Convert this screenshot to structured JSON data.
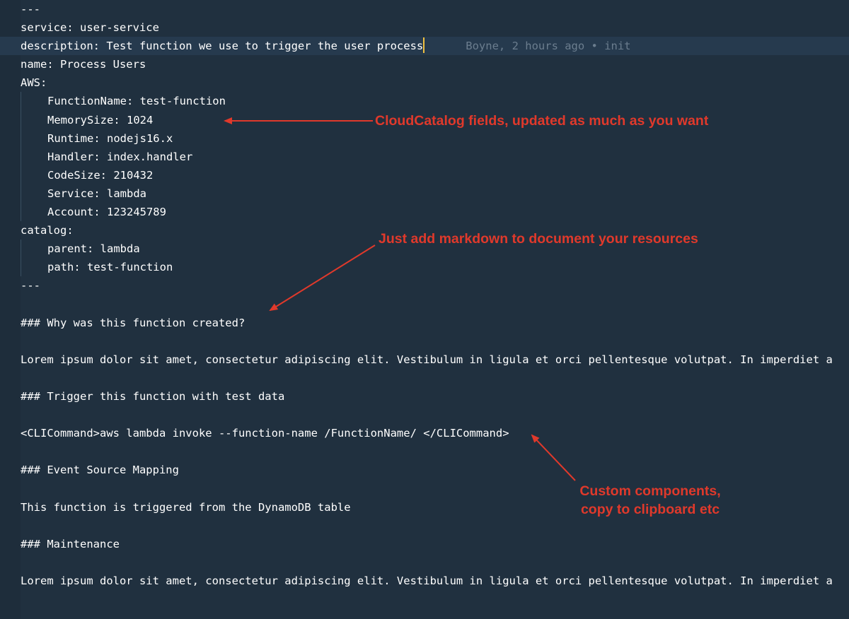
{
  "editor": {
    "lines": [
      {
        "indent": 0,
        "text": "---"
      },
      {
        "indent": 0,
        "text": "service: user-service"
      },
      {
        "indent": 0,
        "text": "description: Test function we use to trigger the user process",
        "active": true,
        "blame": "Boyne, 2 hours ago • init"
      },
      {
        "indent": 0,
        "text": "name: Process Users"
      },
      {
        "indent": 0,
        "text": "AWS:"
      },
      {
        "indent": 1,
        "text": "FunctionName: test-function"
      },
      {
        "indent": 1,
        "text": "MemorySize: 1024"
      },
      {
        "indent": 1,
        "text": "Runtime: nodejs16.x"
      },
      {
        "indent": 1,
        "text": "Handler: index.handler"
      },
      {
        "indent": 1,
        "text": "CodeSize: 210432"
      },
      {
        "indent": 1,
        "text": "Service: lambda"
      },
      {
        "indent": 1,
        "text": "Account: 123245789"
      },
      {
        "indent": 0,
        "text": "catalog:"
      },
      {
        "indent": 1,
        "text": "parent: lambda"
      },
      {
        "indent": 1,
        "text": "path: test-function"
      },
      {
        "indent": 0,
        "text": "---"
      },
      {
        "indent": 0,
        "text": ""
      },
      {
        "indent": 0,
        "text": "### Why was this function created?"
      },
      {
        "indent": 0,
        "text": ""
      },
      {
        "indent": 0,
        "text": "Lorem ipsum dolor sit amet, consectetur adipiscing elit. Vestibulum in ligula et orci pellentesque volutpat. In imperdiet a"
      },
      {
        "indent": 0,
        "text": ""
      },
      {
        "indent": 0,
        "text": "### Trigger this function with test data"
      },
      {
        "indent": 0,
        "text": ""
      },
      {
        "indent": 0,
        "text": "<CLICommand>aws lambda invoke --function-name /FunctionName/ </CLICommand>"
      },
      {
        "indent": 0,
        "text": ""
      },
      {
        "indent": 0,
        "text": "### Event Source Mapping"
      },
      {
        "indent": 0,
        "text": ""
      },
      {
        "indent": 0,
        "text": "This function is triggered from the DynamoDB table"
      },
      {
        "indent": 0,
        "text": ""
      },
      {
        "indent": 0,
        "text": "### Maintenance"
      },
      {
        "indent": 0,
        "text": ""
      },
      {
        "indent": 0,
        "text": "Lorem ipsum dolor sit amet, consectetur adipiscing elit. Vestibulum in ligula et orci pellentesque volutpat. In imperdiet a"
      }
    ]
  },
  "annotations": {
    "fields": "CloudCatalog fields, updated as much as you want",
    "markdown": "Just add markdown to document your resources",
    "components_line1": "Custom components,",
    "components_line2": "copy to clipboard etc"
  },
  "colors": {
    "background": "#20303f",
    "text": "#ffffff",
    "annotation": "#e0392b",
    "cursor": "#f0c040",
    "blame": "#6b7d8e"
  }
}
